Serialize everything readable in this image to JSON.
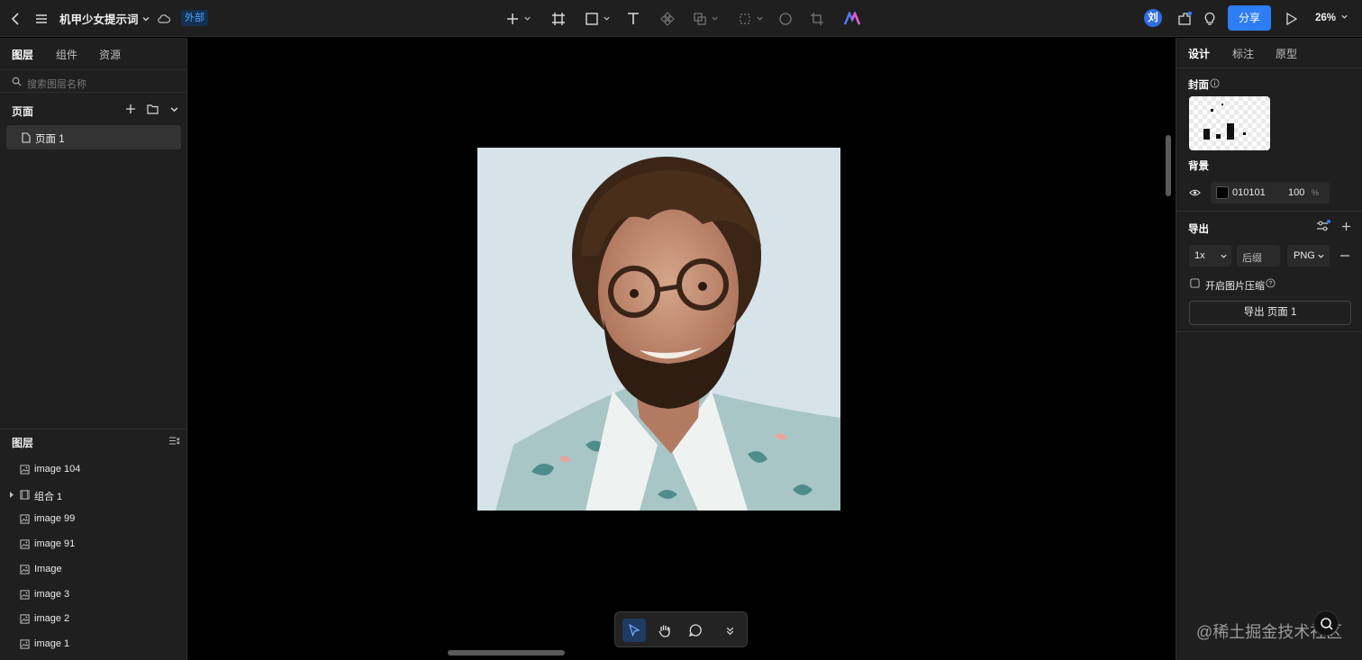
{
  "topbar": {
    "doc_title": "机甲少女提示词",
    "badge": "外部",
    "avatar_initial": "刘",
    "share_label": "分享",
    "zoom": "26%"
  },
  "left": {
    "tabs": [
      "图层",
      "组件",
      "资源"
    ],
    "search_placeholder": "搜索图层名称",
    "pages_title": "页面",
    "pages": [
      {
        "label": "页面 1"
      }
    ],
    "layers_title": "图层",
    "layers": [
      {
        "label": "image 104",
        "type": "image"
      },
      {
        "label": "组合 1",
        "type": "group"
      },
      {
        "label": "image 99",
        "type": "image"
      },
      {
        "label": "image 91",
        "type": "image"
      },
      {
        "label": "Image",
        "type": "image"
      },
      {
        "label": "image 3",
        "type": "image"
      },
      {
        "label": "image 2",
        "type": "image"
      },
      {
        "label": "image 1",
        "type": "image"
      }
    ]
  },
  "right": {
    "tabs": [
      "设计",
      "标注",
      "原型"
    ],
    "cover_title": "封面",
    "background_title": "背景",
    "bg_color_hex": "010101",
    "bg_opacity": "100",
    "bg_opacity_unit": "%",
    "export_title": "导出",
    "export_scale": "1x",
    "export_suffix_placeholder": "后缀",
    "export_format": "PNG",
    "compress_label": "开启图片压缩",
    "export_button": "导出 页面 1"
  },
  "watermark": "@稀土掘金技术社区",
  "colors": {
    "accent": "#2d7df5",
    "panel": "#1f1f1f",
    "canvas": "#000000",
    "artboard_bg": "#d6e4e9"
  }
}
